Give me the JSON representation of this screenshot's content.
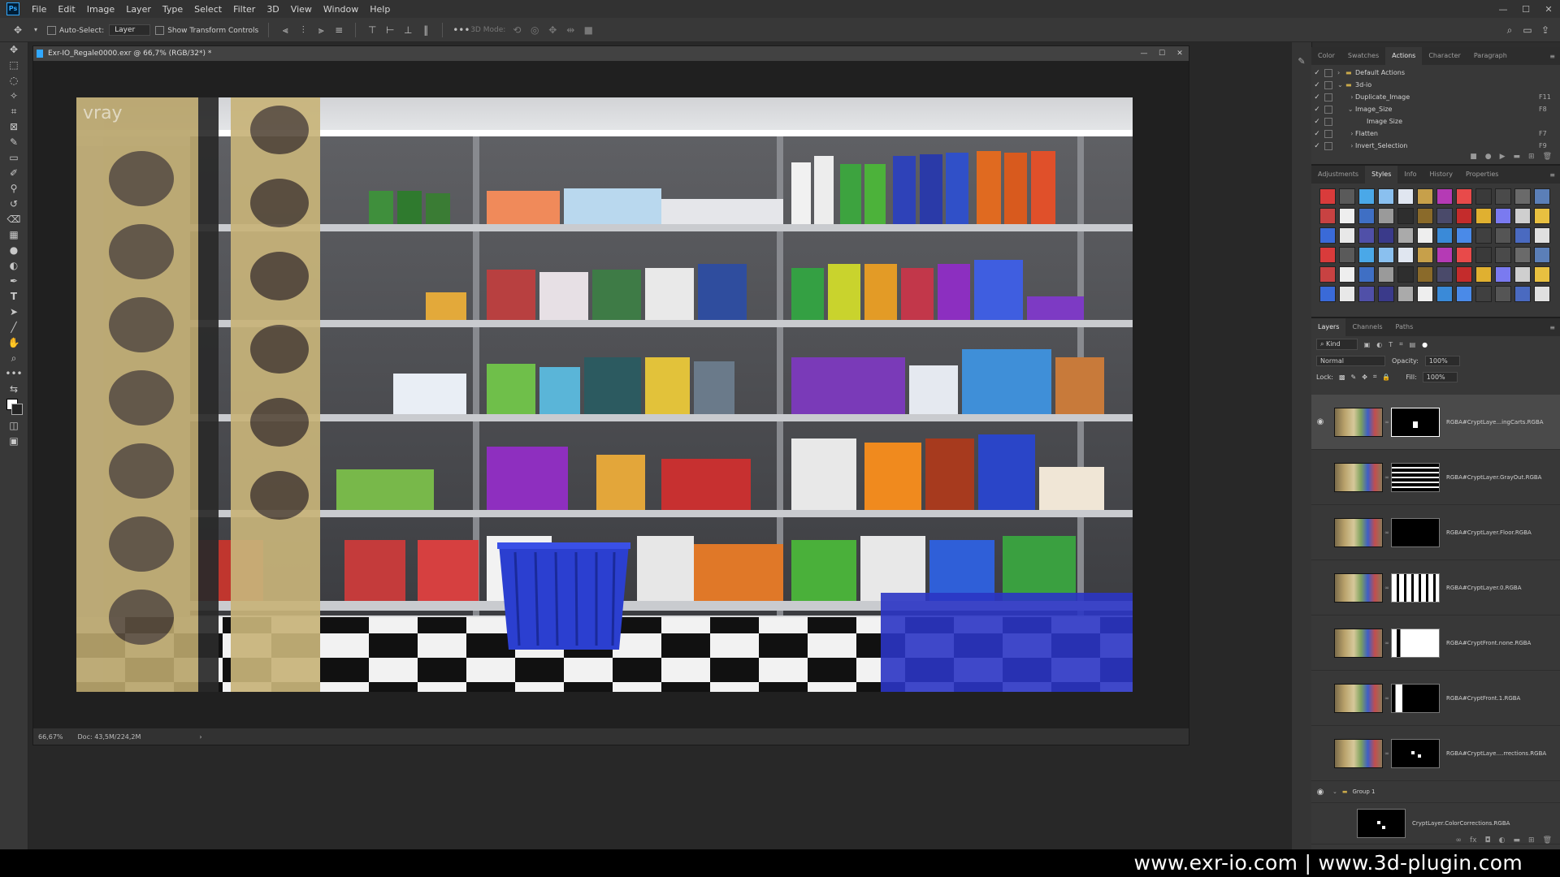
{
  "menubar": {
    "items": [
      "File",
      "Edit",
      "Image",
      "Layer",
      "Type",
      "Select",
      "Filter",
      "3D",
      "View",
      "Window",
      "Help"
    ],
    "window_controls": [
      "—",
      "☐",
      "✕"
    ]
  },
  "optionsbar": {
    "auto_select_label": "Auto-Select:",
    "auto_select_value": "Layer",
    "show_transform_label": "Show Transform Controls",
    "mode_3d_label": "3D Mode:"
  },
  "document": {
    "title": "Exr-IO_Regale0000.exr @ 66,7% (RGB/32*) *",
    "zoom": "66,67%",
    "doc_info": "Doc: 43,5M/224,2M",
    "watermark": "vray"
  },
  "panels": {
    "top_tabs": [
      "Color",
      "Swatches",
      "Actions",
      "Character",
      "Paragraph"
    ],
    "top_active": "Actions",
    "actions": [
      {
        "name": "Default Actions",
        "key": "",
        "indent": 0,
        "type": "set"
      },
      {
        "name": "3d-io",
        "key": "",
        "indent": 0,
        "type": "set"
      },
      {
        "name": "Duplicate_Image",
        "key": "F11",
        "indent": 1,
        "type": "action"
      },
      {
        "name": "Image_Size",
        "key": "F8",
        "indent": 1,
        "type": "action"
      },
      {
        "name": "Image Size",
        "key": "",
        "indent": 2,
        "type": "step"
      },
      {
        "name": "Flatten",
        "key": "F7",
        "indent": 1,
        "type": "action"
      },
      {
        "name": "Invert_Selection",
        "key": "F9",
        "indent": 1,
        "type": "action"
      }
    ],
    "mid_tabs": [
      "Adjustments",
      "Styles",
      "Info",
      "History",
      "Properties"
    ],
    "mid_active": "Styles",
    "layer_tabs": [
      "Layers",
      "Channels",
      "Paths"
    ],
    "layers_active": "Layers",
    "kind_label": "Kind",
    "blend_mode": "Normal",
    "opacity_label": "Opacity:",
    "opacity": "100%",
    "lock_label": "Lock:",
    "fill_label": "Fill:",
    "fill": "100%",
    "layers": [
      {
        "name": "RGBA#CryptLaye...ingCarts.RGBA",
        "visible": true,
        "selected": true
      },
      {
        "name": "RGBA#CryptLayer.GrayOut.RGBA",
        "visible": false,
        "selected": false
      },
      {
        "name": "RGBA#CryptLayer.Floor.RGBA",
        "visible": false,
        "selected": false
      },
      {
        "name": "RGBA#CryptLayer.0.RGBA",
        "visible": false,
        "selected": false
      },
      {
        "name": "RGBA#CryptFront.none.RGBA",
        "visible": false,
        "selected": false
      },
      {
        "name": "RGBA#CryptFront.1.RGBA",
        "visible": false,
        "selected": false
      },
      {
        "name": "RGBA#CryptLaye....rrections.RGBA",
        "visible": false,
        "selected": false
      }
    ],
    "group_name": "Group 1",
    "group_child": "CryptLayer.ColorCorrections.RGBA"
  },
  "footer": {
    "text": "www.exr-io.com  |  www.3d-plugin.com"
  },
  "colors": {
    "accent": "#31a8ff",
    "panel_bg": "#383838",
    "app_bg": "#282828",
    "cart_blue": "#2b3fd0"
  }
}
